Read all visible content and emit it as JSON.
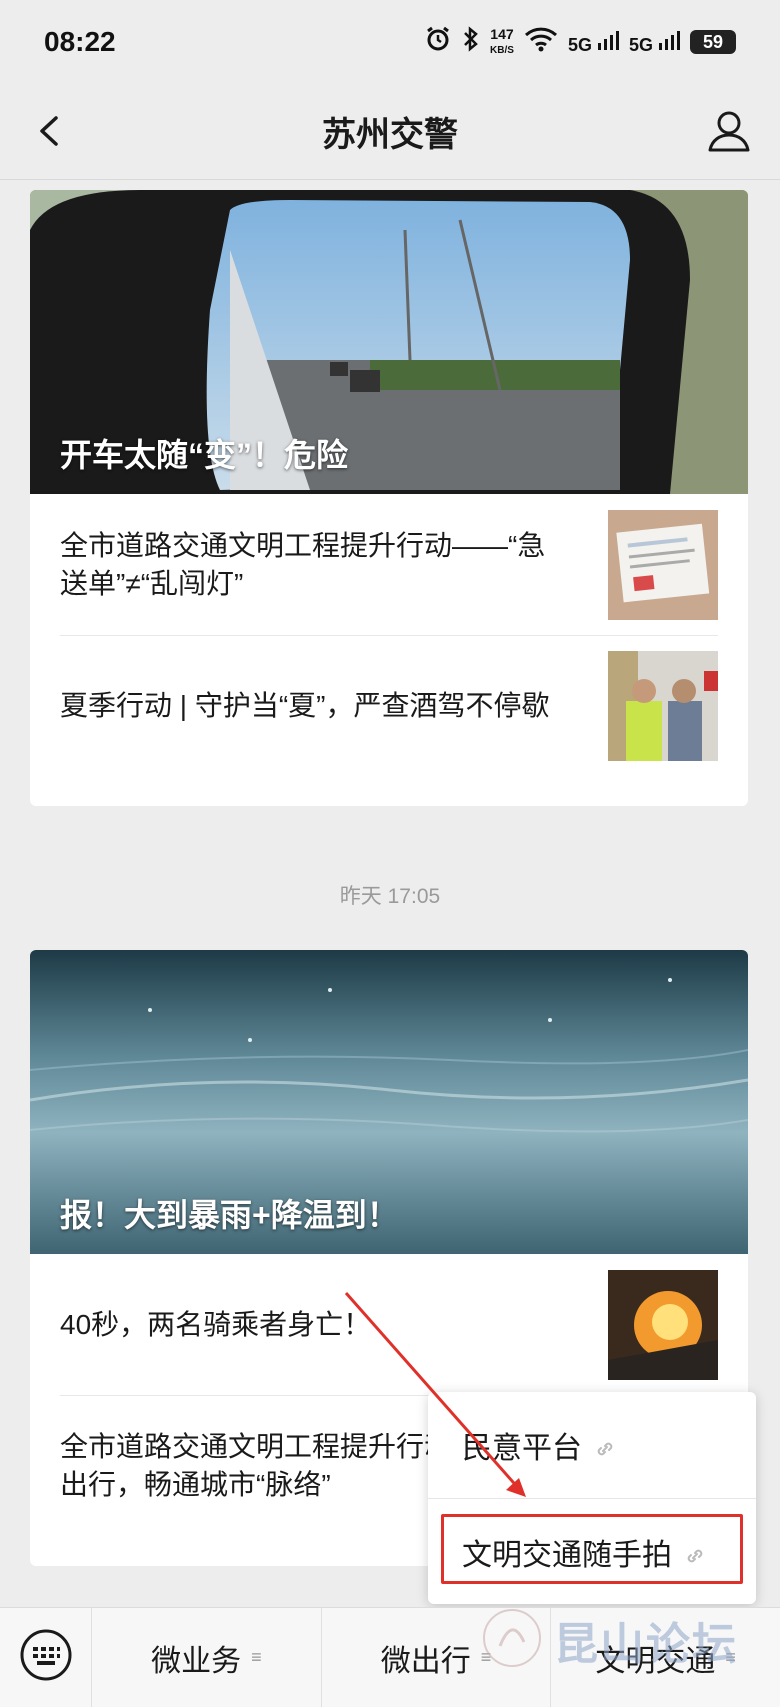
{
  "status_bar": {
    "time": "08:22",
    "network_speed_top": "147",
    "network_speed_unit": "KB/S",
    "signal1": "5G",
    "signal2": "5G",
    "battery": "59"
  },
  "nav": {
    "title": "苏州交警"
  },
  "feed": [
    {
      "hero_title": "开车太随“变”！危险",
      "articles": [
        {
          "title": "全市道路交通文明工程提升行动——“急送单”≠“乱闯灯”"
        },
        {
          "title": "夏季行动 | 守护当“夏”，严查酒驾不停歇"
        }
      ]
    },
    {
      "timestamp": "昨天 17:05",
      "hero_title": "报！大到暴雨+降温到！",
      "articles": [
        {
          "title": "40秒，两名骑乘者身亡！"
        },
        {
          "title": "全市道路交通文明工程提升行动——文明出行，畅通城市“脉络”"
        }
      ]
    }
  ],
  "popup_menu": {
    "items": [
      {
        "label": "民意平台",
        "icon": "link-icon"
      },
      {
        "label": "文明交通随手拍",
        "icon": "link-icon"
      }
    ]
  },
  "bottom_menu": {
    "keyboard_icon": "keyboard-icon",
    "tabs": [
      {
        "label": "微业务"
      },
      {
        "label": "微出行"
      },
      {
        "label": "文明交通"
      }
    ]
  },
  "watermark": {
    "text": "昆山论坛"
  },
  "colors": {
    "highlight": "#e0302a",
    "background": "#ededed"
  }
}
